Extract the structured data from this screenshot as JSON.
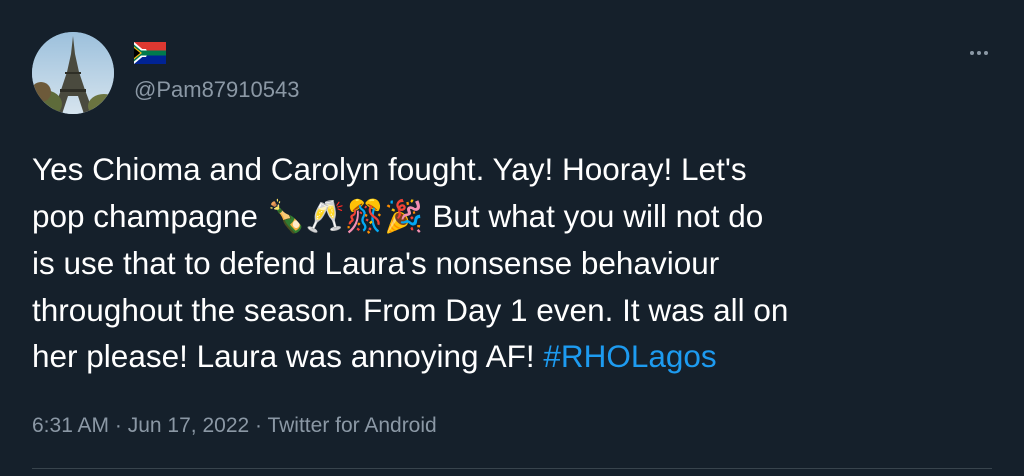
{
  "tweet": {
    "author": {
      "flag_icon": "south-africa-flag-icon",
      "handle": "@Pam87910543",
      "avatar_icon": "eiffel-tower-avatar"
    },
    "more_icon": "more-options-icon",
    "text": {
      "line1": "Yes Chioma and Carolyn fought. Yay! Hooray! Let's",
      "line2_prefix": "pop champagne ",
      "emojis": "🍾🥂🎊🎉",
      "line2_suffix": " But what you will not do",
      "line3": "is use that to defend Laura's nonsense behaviour",
      "line4": "throughout the season. From Day 1 even. It was all on",
      "line5": "her please! Laura was annoying AF! ",
      "hashtag": "#RHOLagos"
    },
    "meta": {
      "time": "6:31 AM",
      "separator": " · ",
      "date": "Jun 17, 2022",
      "source": "Twitter for Android"
    }
  },
  "colors": {
    "background": "#15202b",
    "text": "#ffffff",
    "secondary": "#8b98a5",
    "link": "#1d9bf0"
  }
}
